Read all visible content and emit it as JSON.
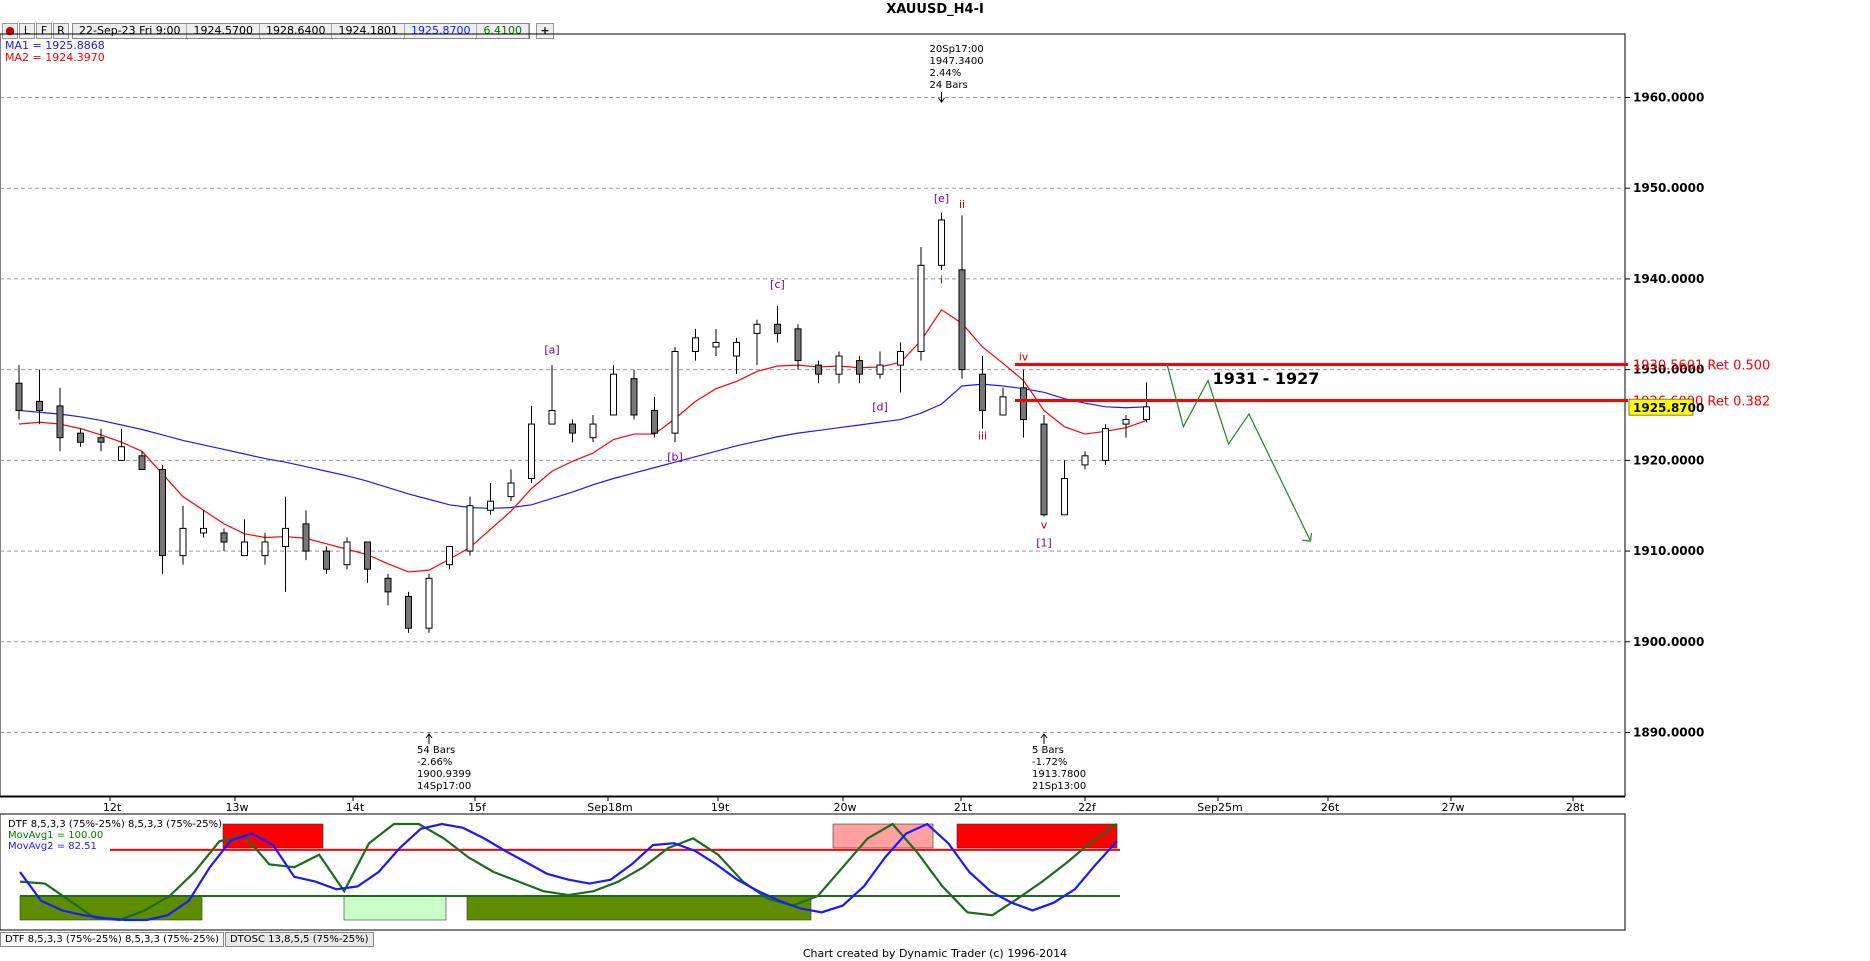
{
  "window": {
    "title": "XAUUSD_H4-I"
  },
  "toolbar": {
    "buttons": [
      "L",
      "F",
      "R"
    ],
    "datetime": "22-Sep-23 Fri 9:00",
    "open": "1924.5700",
    "high": "1928.6400",
    "low": "1924.1801",
    "close": "1925.8700",
    "change": "6.4100",
    "add_label": "+"
  },
  "legend": {
    "ma1": "MA1 = 1925.8868",
    "ma2": "MA2 = 1924.3970"
  },
  "colors": {
    "ma1": "#1a1aff",
    "ma2": "#ff0000",
    "retrace": "#ff0000",
    "projection": "#1a8a1a",
    "wave_label": "#800080",
    "osc_fast": "#1a1aff",
    "osc_slow": "#1e6b1e"
  },
  "chart_data": [
    {
      "type": "candlestick",
      "title": "XAUUSD_H4-I",
      "ylim": [
        1883,
        1967
      ],
      "y_ticks": [
        1890,
        1900,
        1910,
        1920,
        1930,
        1940,
        1950,
        1960
      ],
      "y_tick_labels": [
        "1890.0000",
        "1900.0000",
        "1910.0000",
        "1920.0000",
        "1930.0000",
        "1940.0000",
        "1950.0000",
        "1960.0000"
      ],
      "x_tick_labels": [
        "12t",
        "13w",
        "14t",
        "15f",
        "Sep18m",
        "19t",
        "20w",
        "21t",
        "22f",
        "Sep25m",
        "26t",
        "27w",
        "28t"
      ],
      "last_price_label": "1925.8700",
      "candles": [
        [
          1928.5,
          1925.5,
          1930.5,
          1924.5
        ],
        [
          1926.5,
          1925.5,
          1930,
          1924.0
        ],
        [
          1926,
          1922.5,
          1928,
          1921
        ],
        [
          1923,
          1922,
          1923.5,
          1921.5
        ],
        [
          1922.5,
          1922,
          1923.5,
          1921
        ],
        [
          1920,
          1921.5,
          1923.5,
          1920
        ],
        [
          1920.5,
          1919,
          1921,
          1919
        ],
        [
          1919,
          1909.5,
          1919.5,
          1907.5
        ],
        [
          1909.5,
          1912.5,
          1915,
          1908.5
        ],
        [
          1912,
          1912.5,
          1914.5,
          1911.5
        ],
        [
          1912,
          1911,
          1912.5,
          1910
        ],
        [
          1909.5,
          1911,
          1913.5,
          1909.5
        ],
        [
          1909.5,
          1911,
          1912,
          1908.5
        ],
        [
          1910.5,
          1912.5,
          1916,
          1905.5
        ],
        [
          1913,
          1910,
          1914.5,
          1909
        ],
        [
          1910,
          1908,
          1910.5,
          1907.5
        ],
        [
          1908.5,
          1911,
          1911.5,
          1908
        ],
        [
          1911,
          1908,
          1911,
          1906.5
        ],
        [
          1907,
          1905.5,
          1907.5,
          1904
        ],
        [
          1905,
          1901.5,
          1905.5,
          1901
        ],
        [
          1901.5,
          1907,
          1907.5,
          1901
        ],
        [
          1908.5,
          1910.5,
          1910.5,
          1908
        ],
        [
          1910,
          1915,
          1916,
          1909.5
        ],
        [
          1914.5,
          1915.5,
          1917.5,
          1914
        ],
        [
          1916,
          1917.5,
          1919,
          1915.5
        ],
        [
          1918,
          1924,
          1926,
          1917.5
        ],
        [
          1924,
          1925.5,
          1930.5,
          1924
        ],
        [
          1924,
          1923,
          1924.5,
          1922
        ],
        [
          1922.5,
          1924,
          1925,
          1922
        ],
        [
          1925,
          1929.5,
          1930.5,
          1925
        ],
        [
          1929,
          1925,
          1930,
          1924.5
        ],
        [
          1925.5,
          1923,
          1927,
          1922.5
        ],
        [
          1923,
          1932,
          1932.5,
          1922
        ],
        [
          1932,
          1933.5,
          1934.5,
          1931
        ],
        [
          1932.5,
          1933,
          1934.5,
          1931.5
        ],
        [
          1931.5,
          1933,
          1933.5,
          1929.5
        ],
        [
          1934,
          1935,
          1935.5,
          1930.5
        ],
        [
          1935,
          1934,
          1937,
          1933
        ],
        [
          1934.5,
          1931,
          1935,
          1930
        ],
        [
          1930.5,
          1929.5,
          1931,
          1928.5
        ],
        [
          1929.5,
          1931.5,
          1932,
          1928.5
        ],
        [
          1931,
          1929.5,
          1931.5,
          1928.5
        ],
        [
          1929.5,
          1930.5,
          1932,
          1929
        ],
        [
          1930.5,
          1932,
          1933,
          1927.5
        ],
        [
          1932,
          1941.5,
          1943.5,
          1931
        ],
        [
          1941.5,
          1946.5,
          1947.3,
          1941
        ],
        [
          1941,
          1930,
          1947,
          1929
        ],
        [
          1929.5,
          1925.5,
          1931.5,
          1923.5
        ],
        [
          1925,
          1927,
          1928,
          1925
        ],
        [
          1928,
          1924.5,
          1930,
          1922.5
        ],
        [
          1924,
          1914,
          1925,
          1913.8
        ],
        [
          1914,
          1918,
          1920,
          1915
        ],
        [
          1919.5,
          1920.5,
          1921,
          1919
        ],
        [
          1920,
          1923.5,
          1924,
          1919.5
        ],
        [
          1924,
          1924.5,
          1925,
          1922.5
        ],
        [
          1924.5,
          1925.9,
          1928.6,
          1924.2
        ]
      ],
      "ma1_values": [
        1925.5,
        1925.3,
        1925.1,
        1924.8,
        1924.4,
        1923.9,
        1923.4,
        1922.8,
        1922.2,
        1921.7,
        1921.2,
        1920.7,
        1920.2,
        1919.8,
        1919.3,
        1918.8,
        1918.3,
        1917.7,
        1917.0,
        1916.3,
        1915.7,
        1915.1,
        1914.8,
        1914.7,
        1914.8,
        1915.1,
        1915.8,
        1916.5,
        1917.3,
        1918.0,
        1918.6,
        1919.2,
        1919.8,
        1920.4,
        1921.0,
        1921.6,
        1922.1,
        1922.6,
        1923.0,
        1923.3,
        1923.6,
        1923.9,
        1924.2,
        1924.5,
        1925.2,
        1926.2,
        1928.2,
        1928.4,
        1928.2,
        1927.9,
        1927.5,
        1926.8,
        1926.3,
        1925.9,
        1925.8,
        1925.9
      ],
      "ma2_values": [
        1924.0,
        1924.2,
        1924.0,
        1923.5,
        1922.8,
        1922.0,
        1921.0,
        1918.5,
        1916.0,
        1914.5,
        1913.0,
        1911.9,
        1911.5,
        1911.6,
        1911.4,
        1910.8,
        1910.2,
        1909.6,
        1908.6,
        1907.7,
        1907.9,
        1909.1,
        1910.4,
        1912.4,
        1914.4,
        1916.9,
        1918.8,
        1919.9,
        1920.8,
        1922.3,
        1922.9,
        1922.9,
        1924.6,
        1926.5,
        1927.9,
        1928.7,
        1929.8,
        1930.4,
        1930.5,
        1930.3,
        1930.4,
        1930.2,
        1930.3,
        1930.8,
        1933.2,
        1936.6,
        1935.1,
        1932.5,
        1930.7,
        1928.8,
        1925.5,
        1923.7,
        1922.9,
        1923.2,
        1923.6,
        1924.4
      ],
      "retracement_levels": [
        {
          "value": 1930.5601,
          "label": "1930.5601 Ret 0.500"
        },
        {
          "value": 1926.6,
          "label": "1926.6000 Ret 0.382"
        }
      ],
      "zone_label": "1931 - 1927",
      "wave_labels": [
        {
          "bar": 26,
          "price": 1931.8,
          "text": "[a]",
          "color": "wave"
        },
        {
          "bar": 32,
          "price": 1920.0,
          "text": "[b]",
          "color": "wave"
        },
        {
          "bar": 37,
          "price": 1939.0,
          "text": "[c]",
          "color": "wave"
        },
        {
          "bar": 42,
          "price": 1925.5,
          "text": "[d]",
          "color": "wave"
        },
        {
          "bar": 45,
          "price": 1948.5,
          "text": "[e]",
          "color": "wave"
        },
        {
          "bar": 45,
          "price": 1939.5,
          "text": "i",
          "color": "red"
        },
        {
          "bar": 46,
          "price": 1947.8,
          "text": "ii",
          "color": "red"
        },
        {
          "bar": 47,
          "price": 1922.3,
          "text": "iii",
          "color": "red"
        },
        {
          "bar": 49,
          "price": 1931.0,
          "text": "iv",
          "color": "red"
        },
        {
          "bar": 50,
          "price": 1912.5,
          "text": "v",
          "color": "red"
        },
        {
          "bar": 50,
          "price": 1910.5,
          "text": "[1]",
          "color": "wave"
        }
      ],
      "annotations": [
        {
          "bar": 45,
          "anchor": "top",
          "lines": [
            "20Sp17:00",
            "1947.3400",
            "2.44%",
            "24 Bars"
          ]
        },
        {
          "bar": 20,
          "anchor": "bottom",
          "lines": [
            "54 Bars",
            "-2.66%",
            "1900.9399",
            "14Sp17:00"
          ]
        },
        {
          "bar": 50,
          "anchor": "bottom",
          "lines": [
            "5 Bars",
            "-1.72%",
            "1913.7800",
            "21Sp13:00"
          ]
        }
      ],
      "projection_path": [
        [
          56,
          1930.6
        ],
        [
          56.8,
          1923.7
        ],
        [
          58,
          1928.8
        ],
        [
          59,
          1921.8
        ],
        [
          60,
          1925.1
        ],
        [
          63,
          1911.1
        ]
      ]
    },
    {
      "type": "line",
      "title": "DTF 8,5,3,3 (75%-25%) 8,5,3,3 (75%-25%)",
      "ylim": [
        0,
        100
      ],
      "legend": [
        "MovAvg1 = 100.00",
        "MovAvg2 = 82.51"
      ],
      "upper_band": 75,
      "lower_band": 25,
      "red_line": 73,
      "series": [
        {
          "name": "MovAvg1",
          "values": [
            50,
            20,
            10,
            5,
            2,
            0,
            0,
            5,
            20,
            55,
            83,
            90,
            78,
            45,
            40,
            32,
            35,
            50,
            75,
            95,
            100,
            96,
            85,
            72,
            60,
            48,
            42,
            38,
            42,
            58,
            78,
            80,
            72,
            58,
            42,
            30,
            20,
            12,
            8,
            15,
            35,
            65,
            90,
            100,
            80,
            50,
            30,
            18,
            10,
            18,
            32,
            58,
            82
          ]
        },
        {
          "name": "MovAvg2",
          "values": [
            40,
            38,
            20,
            2,
            0,
            10,
            25,
            50,
            82,
            88,
            58,
            55,
            68,
            30,
            80,
            100,
            100,
            85,
            65,
            50,
            40,
            30,
            26,
            30,
            40,
            55,
            75,
            85,
            68,
            40,
            22,
            15,
            25,
            55,
            85,
            100,
            70,
            35,
            8,
            5,
            22,
            40,
            60,
            82,
            100
          ]
        }
      ],
      "bands": [
        {
          "type": "red",
          "label": ""
        },
        {
          "type": "pink",
          "label": ""
        },
        {
          "type": "red",
          "label": ""
        },
        {
          "type": "green",
          "label": ""
        },
        {
          "type": "lightgreen",
          "label": ""
        },
        {
          "type": "green",
          "label": ""
        }
      ]
    }
  ],
  "tabs": [
    "DTF 8,5,3,3 (75%-25%) 8,5,3,3 (75%-25%)",
    "DTOSC 13,8,5,5 (75%-25%)"
  ],
  "footer": {
    "credit": "Chart created by Dynamic Trader  (c)  1996-2014"
  }
}
